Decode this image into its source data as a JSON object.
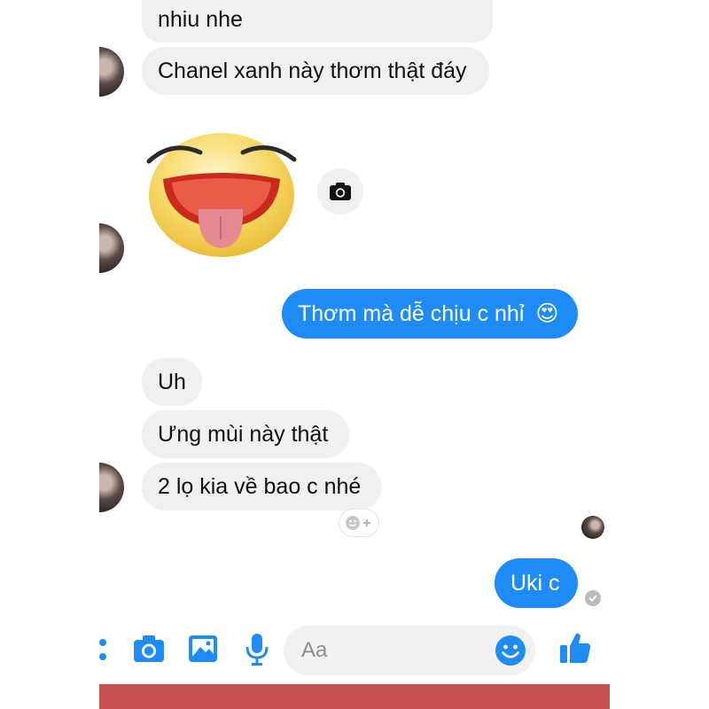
{
  "messages": {
    "m1": "nhiu nhe",
    "m2": "Chanel xanh này thơm thật đáy",
    "m3": "Thơm mà dễ chịu c nhỉ",
    "m3_emoji": "😍",
    "m4": "Uh",
    "m5": "Ưng mùi này thật",
    "m6": "2 lọ kia về bao c nhé",
    "m7": "Uki c"
  },
  "composer": {
    "placeholder": "Aa"
  },
  "icons": {
    "more": "more-dots-icon",
    "camera": "camera-icon",
    "gallery": "gallery-icon",
    "mic": "microphone-icon",
    "emoji": "emoji-icon",
    "like": "thumbs-up-icon",
    "sticker": "laughing-tongue-sticker",
    "add_reaction": "add-reaction-icon",
    "seen": "seen-check-icon"
  },
  "colors": {
    "accent": "#1f8cf5",
    "incoming_bubble": "#f1f0f0",
    "bottom_bar": "#c5504e"
  }
}
